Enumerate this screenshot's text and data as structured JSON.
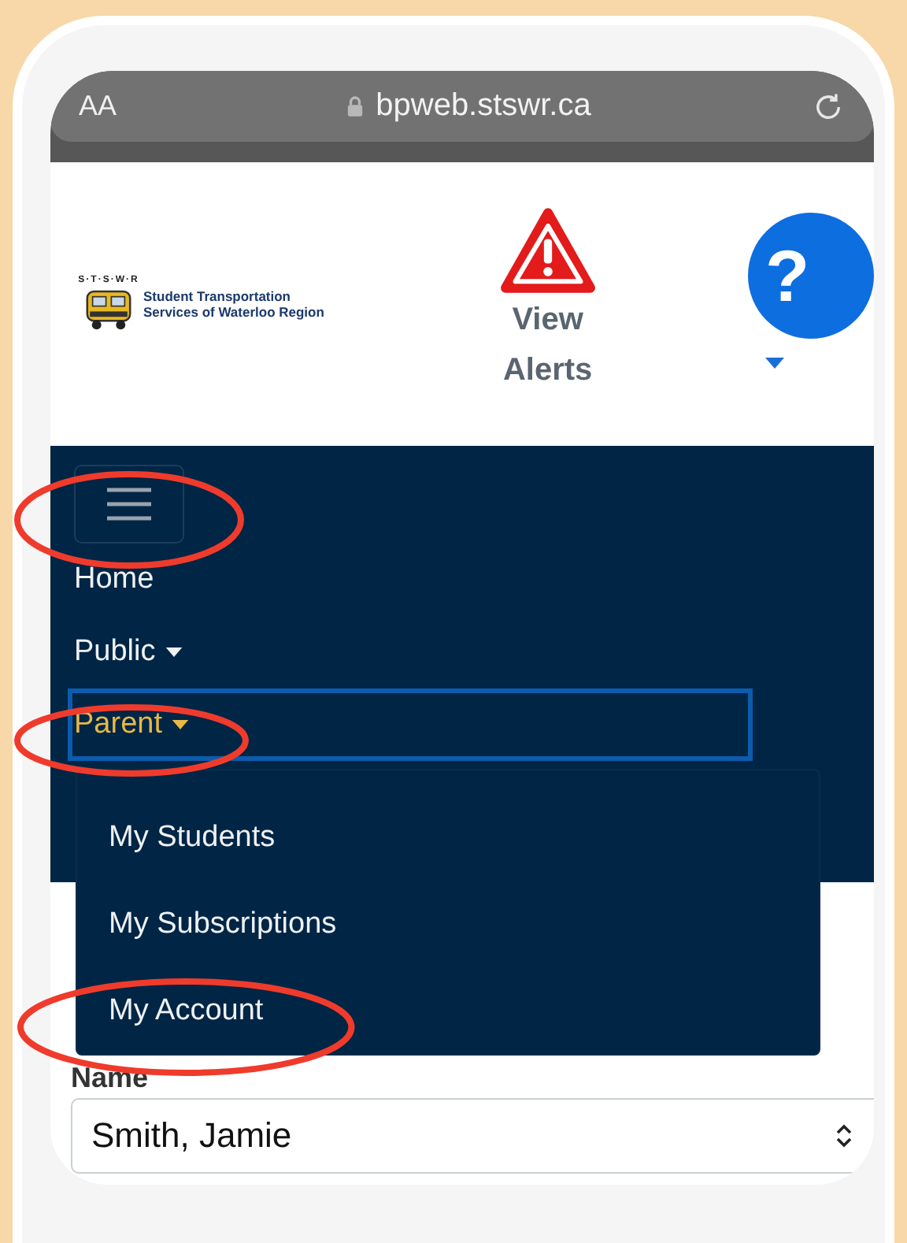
{
  "browser": {
    "text_size": "AA",
    "url": "bpweb.stswr.ca"
  },
  "header": {
    "logo": {
      "mark": "S·T·S·W·R",
      "lines": [
        "Student Transportation",
        "Services of Waterloo Region"
      ]
    },
    "alerts": {
      "label": "View Alerts"
    },
    "help": {
      "label": "?"
    }
  },
  "nav": {
    "toggle": {
      "circled": true
    },
    "items": [
      {
        "label": "Home",
        "dropdown": false,
        "selected": false,
        "circled": false
      },
      {
        "label": "Public",
        "dropdown": true,
        "selected": false,
        "circled": false
      },
      {
        "label": "Parent",
        "dropdown": true,
        "selected": true,
        "circled": true
      }
    ]
  },
  "dropdown_menu": {
    "items": [
      {
        "label": "My Students",
        "circled": false
      },
      {
        "label": "My Subscriptions",
        "circled": false
      },
      {
        "label": "My Account",
        "circled": true
      }
    ]
  },
  "form": {
    "label": "Name",
    "select": {
      "value": "Smith, Jamie"
    }
  }
}
